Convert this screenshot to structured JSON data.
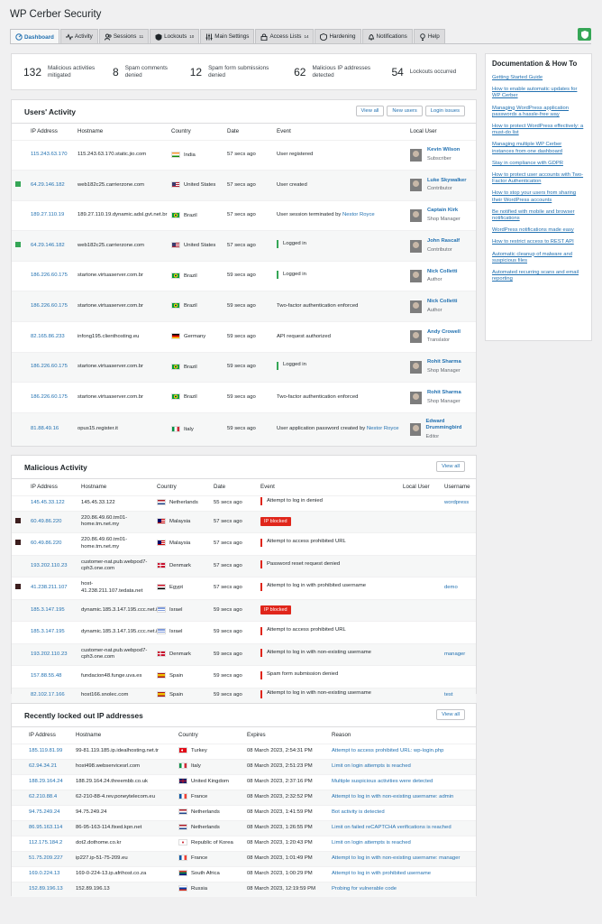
{
  "app": {
    "title": "WP Cerber Security"
  },
  "tabs": [
    {
      "label": "Dashboard",
      "icon": "dashboard-icon",
      "badge": ""
    },
    {
      "label": "Activity",
      "icon": "activity-icon",
      "badge": ""
    },
    {
      "label": "Sessions",
      "icon": "sessions-icon",
      "badge": "11"
    },
    {
      "label": "Lockouts",
      "icon": "lockouts-icon",
      "badge": "10"
    },
    {
      "label": "Main Settings",
      "icon": "settings-icon",
      "badge": ""
    },
    {
      "label": "Access Lists",
      "icon": "lock-icon",
      "badge": "14"
    },
    {
      "label": "Hardening",
      "icon": "hardening-icon",
      "badge": ""
    },
    {
      "label": "Notifications",
      "icon": "bell-icon",
      "badge": ""
    },
    {
      "label": "Help",
      "icon": "help-icon",
      "badge": ""
    }
  ],
  "stats": [
    {
      "num": "132",
      "label": "Malicious activities mitigated"
    },
    {
      "num": "8",
      "label": "Spam comments denied"
    },
    {
      "num": "12",
      "label": "Spam form submissions denied"
    },
    {
      "num": "62",
      "label": "Malicious IP addresses detected"
    },
    {
      "num": "54",
      "label": "Lockouts occurred"
    }
  ],
  "users_activity": {
    "title": "Users' Activity",
    "buttons": [
      "View all",
      "New users",
      "Login issues"
    ],
    "columns": [
      "IP Address",
      "Hostname",
      "Country",
      "Date",
      "Event",
      "Local User"
    ],
    "rows": [
      {
        "ip": "115.243.63.170",
        "host": "115.243.63.170.static.jio.com",
        "country": "India",
        "flag": "in",
        "date": "57 secs ago",
        "event": "User registered",
        "user": "Kevin Wilson",
        "role": "Subscriber",
        "marker": "",
        "bar": ""
      },
      {
        "ip": "64.29.146.182",
        "host": "web182c25.carrierzone.com",
        "country": "United States",
        "flag": "us",
        "date": "57 secs ago",
        "event": "User created",
        "user": "Luke Skywalker",
        "role": "Contributor",
        "marker": "#35a656",
        "bar": ""
      },
      {
        "ip": "189.27.110.19",
        "host": "189.27.110.19.dynamic.adsl.gvt.net.br",
        "country": "Brazil",
        "flag": "br",
        "date": "57 secs ago",
        "event": "User session terminated by",
        "event_link": "Nestor Royce",
        "user": "Captain Kirk",
        "role": "Shop Manager",
        "marker": "",
        "bar": ""
      },
      {
        "ip": "64.29.146.182",
        "host": "web182c25.carrierzone.com",
        "country": "United States",
        "flag": "us",
        "date": "57 secs ago",
        "event": "Logged in",
        "user": "John Rascalf",
        "role": "Contributor",
        "marker": "#35a656",
        "bar": "#35a656"
      },
      {
        "ip": "186.226.60.175",
        "host": "startone.virtuaserver.com.br",
        "country": "Brazil",
        "flag": "br",
        "date": "59 secs ago",
        "event": "Logged in",
        "user": "Nick Colletti",
        "role": "Author",
        "marker": "",
        "bar": "#35a656"
      },
      {
        "ip": "186.226.60.175",
        "host": "startone.virtuaserver.com.br",
        "country": "Brazil",
        "flag": "br",
        "date": "59 secs ago",
        "event": "Two-factor authentication enforced",
        "user": "Nick Colletti",
        "role": "Author",
        "marker": "",
        "bar": ""
      },
      {
        "ip": "82.165.86.233",
        "host": "infong195.clienthosting.eu",
        "country": "Germany",
        "flag": "de",
        "date": "59 secs ago",
        "event": "API request authorized",
        "user": "Andy Crowell",
        "role": "Translator",
        "marker": "",
        "bar": ""
      },
      {
        "ip": "186.226.60.175",
        "host": "startone.virtuaserver.com.br",
        "country": "Brazil",
        "flag": "br",
        "date": "59 secs ago",
        "event": "Logged in",
        "user": "Rohit Sharma",
        "role": "Shop Manager",
        "marker": "",
        "bar": "#35a656"
      },
      {
        "ip": "186.226.60.175",
        "host": "startone.virtuaserver.com.br",
        "country": "Brazil",
        "flag": "br",
        "date": "59 secs ago",
        "event": "Two-factor authentication enforced",
        "user": "Rohit Sharma",
        "role": "Shop Manager",
        "marker": "",
        "bar": ""
      },
      {
        "ip": "81.88.49.16",
        "host": "opus15.register.it",
        "country": "Italy",
        "flag": "it",
        "date": "59 secs ago",
        "event": "User application password created by",
        "event_link": "Nestor Royce",
        "user": "Edward Drummingbird",
        "role": "Editor",
        "marker": "",
        "bar": ""
      }
    ]
  },
  "malicious": {
    "title": "Malicious Activity",
    "buttons": [
      "View all"
    ],
    "columns": [
      "IP Address",
      "Hostname",
      "Country",
      "Date",
      "Event",
      "Local User",
      "Username"
    ],
    "rows": [
      {
        "ip": "145.45.33.122",
        "host": "145.45.33.122",
        "country": "Netherlands",
        "flag": "nl",
        "date": "55 secs ago",
        "event": "Attempt to log in denied",
        "badge": false,
        "username": "wordpress",
        "marker": ""
      },
      {
        "ip": "60.49.86.220",
        "host": "220.86.49.60.tm01-home.tm.net.my",
        "country": "Malaysia",
        "flag": "my",
        "date": "57 secs ago",
        "event": "IP blocked",
        "badge": true,
        "username": "",
        "marker": "#3c1e1e"
      },
      {
        "ip": "60.49.86.220",
        "host": "220.86.49.60.tm01-home.tm.net.my",
        "country": "Malaysia",
        "flag": "my",
        "date": "57 secs ago",
        "event": "Attempt to access prohibited URL",
        "badge": false,
        "username": "",
        "marker": "#3c1e1e"
      },
      {
        "ip": "193.202.110.23",
        "host": "customer-nat.pub.webpod7-cph3.one.com",
        "country": "Denmark",
        "flag": "dk",
        "date": "57 secs ago",
        "event": "Password reset request denied",
        "badge": false,
        "username": "",
        "marker": ""
      },
      {
        "ip": "41.238.211.107",
        "host": "host-41.238.211.107.tedata.net",
        "country": "Egypt",
        "flag": "eg",
        "date": "57 secs ago",
        "event": "Attempt to log in with prohibited username",
        "badge": false,
        "username": "demo",
        "marker": "#3c1e1e"
      },
      {
        "ip": "185.3.147.195",
        "host": "dynamic.185.3.147.195.ccc.net.il",
        "country": "Israel",
        "flag": "il",
        "date": "59 secs ago",
        "event": "IP blocked",
        "badge": true,
        "username": "",
        "marker": ""
      },
      {
        "ip": "185.3.147.195",
        "host": "dynamic.185.3.147.195.ccc.net.il",
        "country": "Israel",
        "flag": "il",
        "date": "59 secs ago",
        "event": "Attempt to access prohibited URL",
        "badge": false,
        "username": "",
        "marker": ""
      },
      {
        "ip": "193.202.110.23",
        "host": "customer-nat.pub.webpod7-cph3.one.com",
        "country": "Denmark",
        "flag": "dk",
        "date": "59 secs ago",
        "event": "Attempt to log in with non-existing username",
        "badge": false,
        "username": "manager",
        "marker": ""
      },
      {
        "ip": "157.88.55.48",
        "host": "fundacion48.funge.uva.es",
        "country": "Spain",
        "flag": "es",
        "date": "59 secs ago",
        "event": "Spam form submission denied",
        "badge": false,
        "username": "",
        "marker": ""
      },
      {
        "ip": "82.102.17.166",
        "host": "host166.snolec.com",
        "country": "Spain",
        "flag": "es",
        "date": "59 secs ago",
        "event": "Attempt to log in with non-existing username",
        "badge": false,
        "username": "test",
        "marker": ""
      }
    ]
  },
  "lockouts": {
    "title": "Recently locked out IP addresses",
    "buttons": [
      "View all"
    ],
    "columns": [
      "IP Address",
      "Hostname",
      "Country",
      "Expires",
      "Reason"
    ],
    "rows": [
      {
        "ip": "185.119.81.99",
        "host": "99-81.119.185.ip.idealhosting.net.tr",
        "country": "Turkey",
        "flag": "tr",
        "expires": "08 March 2023, 2:54:31 PM",
        "reason": "Attempt to access prohibited URL: wp-login.php"
      },
      {
        "ip": "62.94.34.21",
        "host": "host498.webservicesrl.com",
        "country": "Italy",
        "flag": "it",
        "expires": "08 March 2023, 2:51:23 PM",
        "reason": "Limit on login attempts is reached"
      },
      {
        "ip": "188.29.164.24",
        "host": "188.29.164.24.threembb.co.uk",
        "country": "United Kingdom",
        "flag": "gb",
        "expires": "08 March 2023, 2:37:16 PM",
        "reason": "Multiple suspicious activities were detected"
      },
      {
        "ip": "62.210.88.4",
        "host": "62-210-88-4.rev.poneytelecom.eu",
        "country": "France",
        "flag": "fr",
        "expires": "08 March 2023, 2:32:52 PM",
        "reason": "Attempt to log in with non-existing username: admin"
      },
      {
        "ip": "94.75.249.24",
        "host": "94.75.249.24",
        "country": "Netherlands",
        "flag": "nl",
        "expires": "08 March 2023, 1:41:59 PM",
        "reason": "Bot activity is detected"
      },
      {
        "ip": "86.95.163.114",
        "host": "86-95-163-114.fixed.kpn.net",
        "country": "Netherlands",
        "flag": "nl",
        "expires": "08 March 2023, 1:26:55 PM",
        "reason": "Limit on failed reCAPTCHA verifications is reached"
      },
      {
        "ip": "112.175.184.2",
        "host": "dot2.dothome.co.kr",
        "country": "Republic of Korea",
        "flag": "kr",
        "expires": "08 March 2023, 1:20:43 PM",
        "reason": "Limit on login attempts is reached"
      },
      {
        "ip": "51.75.209.227",
        "host": "ip227.ip-51-75-209.eu",
        "country": "France",
        "flag": "fr",
        "expires": "08 March 2023, 1:01:49 PM",
        "reason": "Attempt to log in with non-existing username: manager"
      },
      {
        "ip": "169.0.224.13",
        "host": "169-0-224-13.ip.afrihost.co.za",
        "country": "South Africa",
        "flag": "za",
        "expires": "08 March 2023, 1:00:29 PM",
        "reason": "Attempt to log in with prohibited username"
      },
      {
        "ip": "152.89.196.13",
        "host": "152.89.196.13",
        "country": "Russia",
        "flag": "ru",
        "expires": "08 March 2023, 12:19:59 PM",
        "reason": "Probing for vulnerable code"
      }
    ]
  },
  "docs": {
    "title": "Documentation & How To",
    "links": [
      "Getting Started Guide",
      "How to enable automatic updates for WP Cerber",
      "Managing WordPress application passwords a hassle-free way",
      "How to protect WordPress effectively: a must-do list",
      "Managing multiple WP Cerber instances from one dashboard",
      "Stay in compliance with GDPR",
      "How to protect user accounts with Two-Factor Authentication",
      "How to stop your users from sharing their WordPress accounts",
      "Be notified with mobile and browser notifications",
      "WordPress notifications made easy",
      "How to restrict access to REST API",
      "Automatic cleanup of malware and suspicious files",
      "Automated recurring scans and email reporting"
    ]
  }
}
